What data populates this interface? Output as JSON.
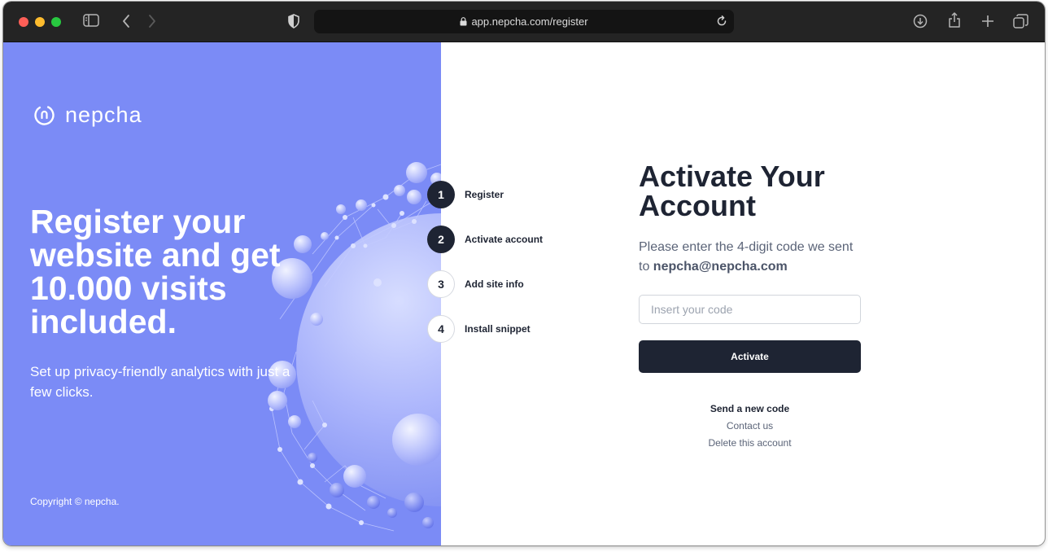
{
  "browser": {
    "url": "app.nepcha.com/register"
  },
  "brand": {
    "name": "nepcha",
    "accent_color": "#7b8bf6",
    "dark_color": "#1e2433"
  },
  "left": {
    "headline": "Register your website and get 10.000 visits included.",
    "subline": "Set up privacy-friendly analytics with just a few clicks.",
    "copyright": "Copyright © nepcha."
  },
  "steps": [
    {
      "number": "1",
      "label": "Register",
      "state": "done"
    },
    {
      "number": "2",
      "label": "Activate account",
      "state": "current"
    },
    {
      "number": "3",
      "label": "Add site info",
      "state": "todo"
    },
    {
      "number": "4",
      "label": "Install snippet",
      "state": "todo"
    }
  ],
  "form": {
    "title": "Activate Your Account",
    "description_prefix": "Please enter the 4-digit code we sent to ",
    "email": "nepcha@nepcha.com",
    "code_placeholder": "Insert your code",
    "code_value": "",
    "submit_label": "Activate",
    "links": {
      "resend": "Send a new code",
      "contact": "Contact us",
      "delete": "Delete this account"
    }
  }
}
